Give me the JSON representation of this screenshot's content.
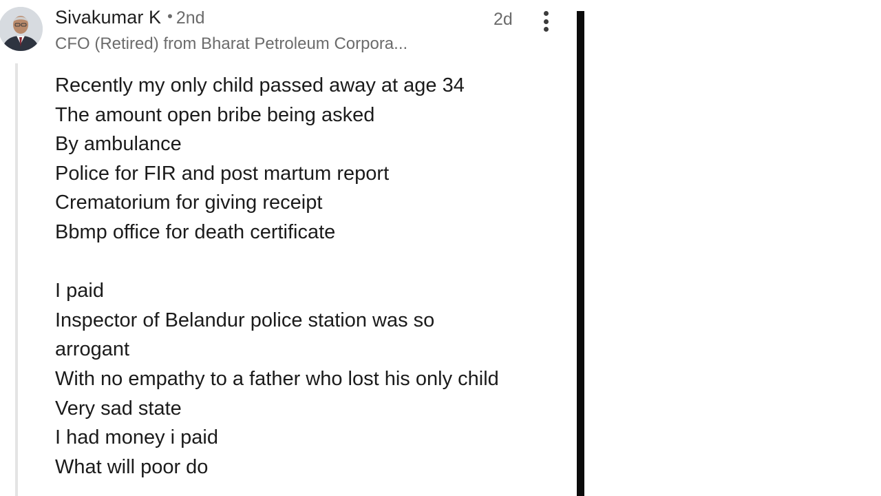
{
  "comment": {
    "author": {
      "name": "Sivakumar K",
      "separator": "•",
      "connection_degree": "2nd",
      "headline": "CFO (Retired) from Bharat Petroleum Corpora..."
    },
    "timestamp": "2d",
    "more_menu_icon": "more-vertical-icon",
    "avatar_icon": "profile-photo",
    "lines": [
      "Recently my only child passed away at age 34",
      "The amount open bribe being asked",
      "By ambulance",
      "Police for FIR and post martum report",
      "Crematorium  for giving receipt",
      "Bbmp office for death certificate",
      "",
      "I paid",
      "Inspector of Belandur police station was so",
      "arrogant",
      "With no empathy to a father who lost his only child",
      "Very sad state",
      "I had money i paid",
      "What will poor do"
    ]
  },
  "colors": {
    "background": "#ffffff",
    "primary_text": "#1b1b1b",
    "secondary_text": "#6b6b6b",
    "thread_line": "#e4e4e4",
    "side_bar": "#0b0b0b"
  }
}
